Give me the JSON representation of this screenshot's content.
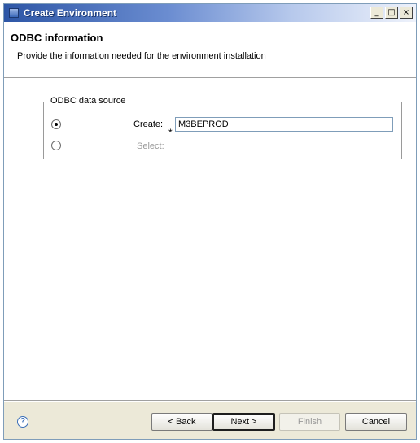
{
  "window": {
    "title": "Create Environment",
    "controls": {
      "minimize": "_",
      "maximize": "□",
      "close": "×"
    }
  },
  "header": {
    "title": "ODBC information",
    "description": "Provide the information needed for the environment installation"
  },
  "odbc_group": {
    "legend": "ODBC data source",
    "create": {
      "label": "Create:",
      "selected": true,
      "required_marker": "*",
      "value": "M3BEPROD"
    },
    "select": {
      "label": "Select:",
      "selected": false
    }
  },
  "footer": {
    "help_icon": "help-icon",
    "help_glyph": "?",
    "back_label": "< Back",
    "next_label": "Next >",
    "finish_label": "Finish",
    "cancel_label": "Cancel"
  }
}
